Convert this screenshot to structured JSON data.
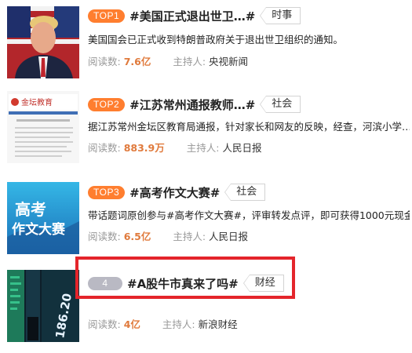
{
  "items": [
    {
      "rank": "TOP1",
      "topic": "#美国正式退出世卫…#",
      "category": "时事",
      "desc": "美国国会已正式收到特朗普政府关于退出世卫组织的通知。",
      "read_label": "阅读数:",
      "read_count": "7.6亿",
      "host_label": "主持人:",
      "host": "央视新闻"
    },
    {
      "rank": "TOP2",
      "topic": "#江苏常州通报教师…#",
      "category": "社会",
      "desc": "据江苏常州金坛区教育局通报，针对家长和网友的反映，经查，河滨小学…",
      "read_label": "阅读数:",
      "read_count": "883.9万",
      "host_label": "主持人:",
      "host": "人民日报",
      "thumb_text": "金坛教育"
    },
    {
      "rank": "TOP3",
      "topic": "#高考作文大赛#",
      "category": "社会",
      "desc": "带话题词原创参与#高考作文大赛#，评审转发点评，即可获得1000元现金…",
      "read_label": "阅读数:",
      "read_count": "6.5亿",
      "host_label": "主持人:",
      "host": "人民日报",
      "thumb_line1": "高考",
      "thumb_line2": "作文大赛"
    },
    {
      "rank": "4",
      "topic": "#A股牛市真来了吗#",
      "category": "财经",
      "read_label": "阅读数:",
      "read_count": "4亿",
      "host_label": "主持人:",
      "host": "新浪财经",
      "thumb_text": "186.20"
    }
  ],
  "colors": {
    "rank_top": "#ff7e2f",
    "rank_plain": "#b9b9c3",
    "read_count": "#e07a3c",
    "highlight_border": "#e4252b"
  }
}
